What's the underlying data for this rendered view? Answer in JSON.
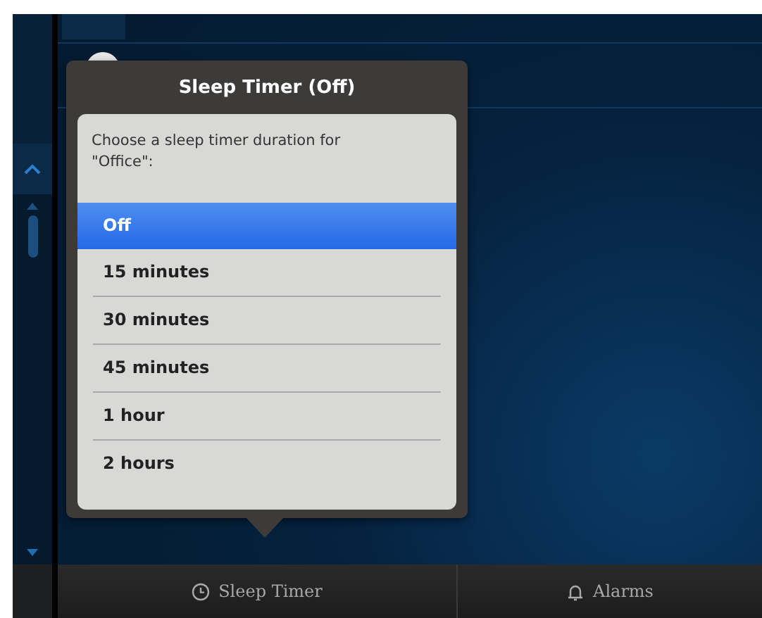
{
  "popup": {
    "title": "Sleep Timer (Off)",
    "prompt": "Choose a sleep timer duration for \"Office\":",
    "options": [
      {
        "label": "Off",
        "selected": true
      },
      {
        "label": "15 minutes",
        "selected": false
      },
      {
        "label": "30 minutes",
        "selected": false
      },
      {
        "label": "45 minutes",
        "selected": false
      },
      {
        "label": "1 hour",
        "selected": false
      },
      {
        "label": "2 hours",
        "selected": false
      }
    ]
  },
  "bottom_bar": [
    {
      "label": "Sleep Timer",
      "kind": "timer"
    },
    {
      "label": "Alarms",
      "kind": "alarm"
    }
  ]
}
